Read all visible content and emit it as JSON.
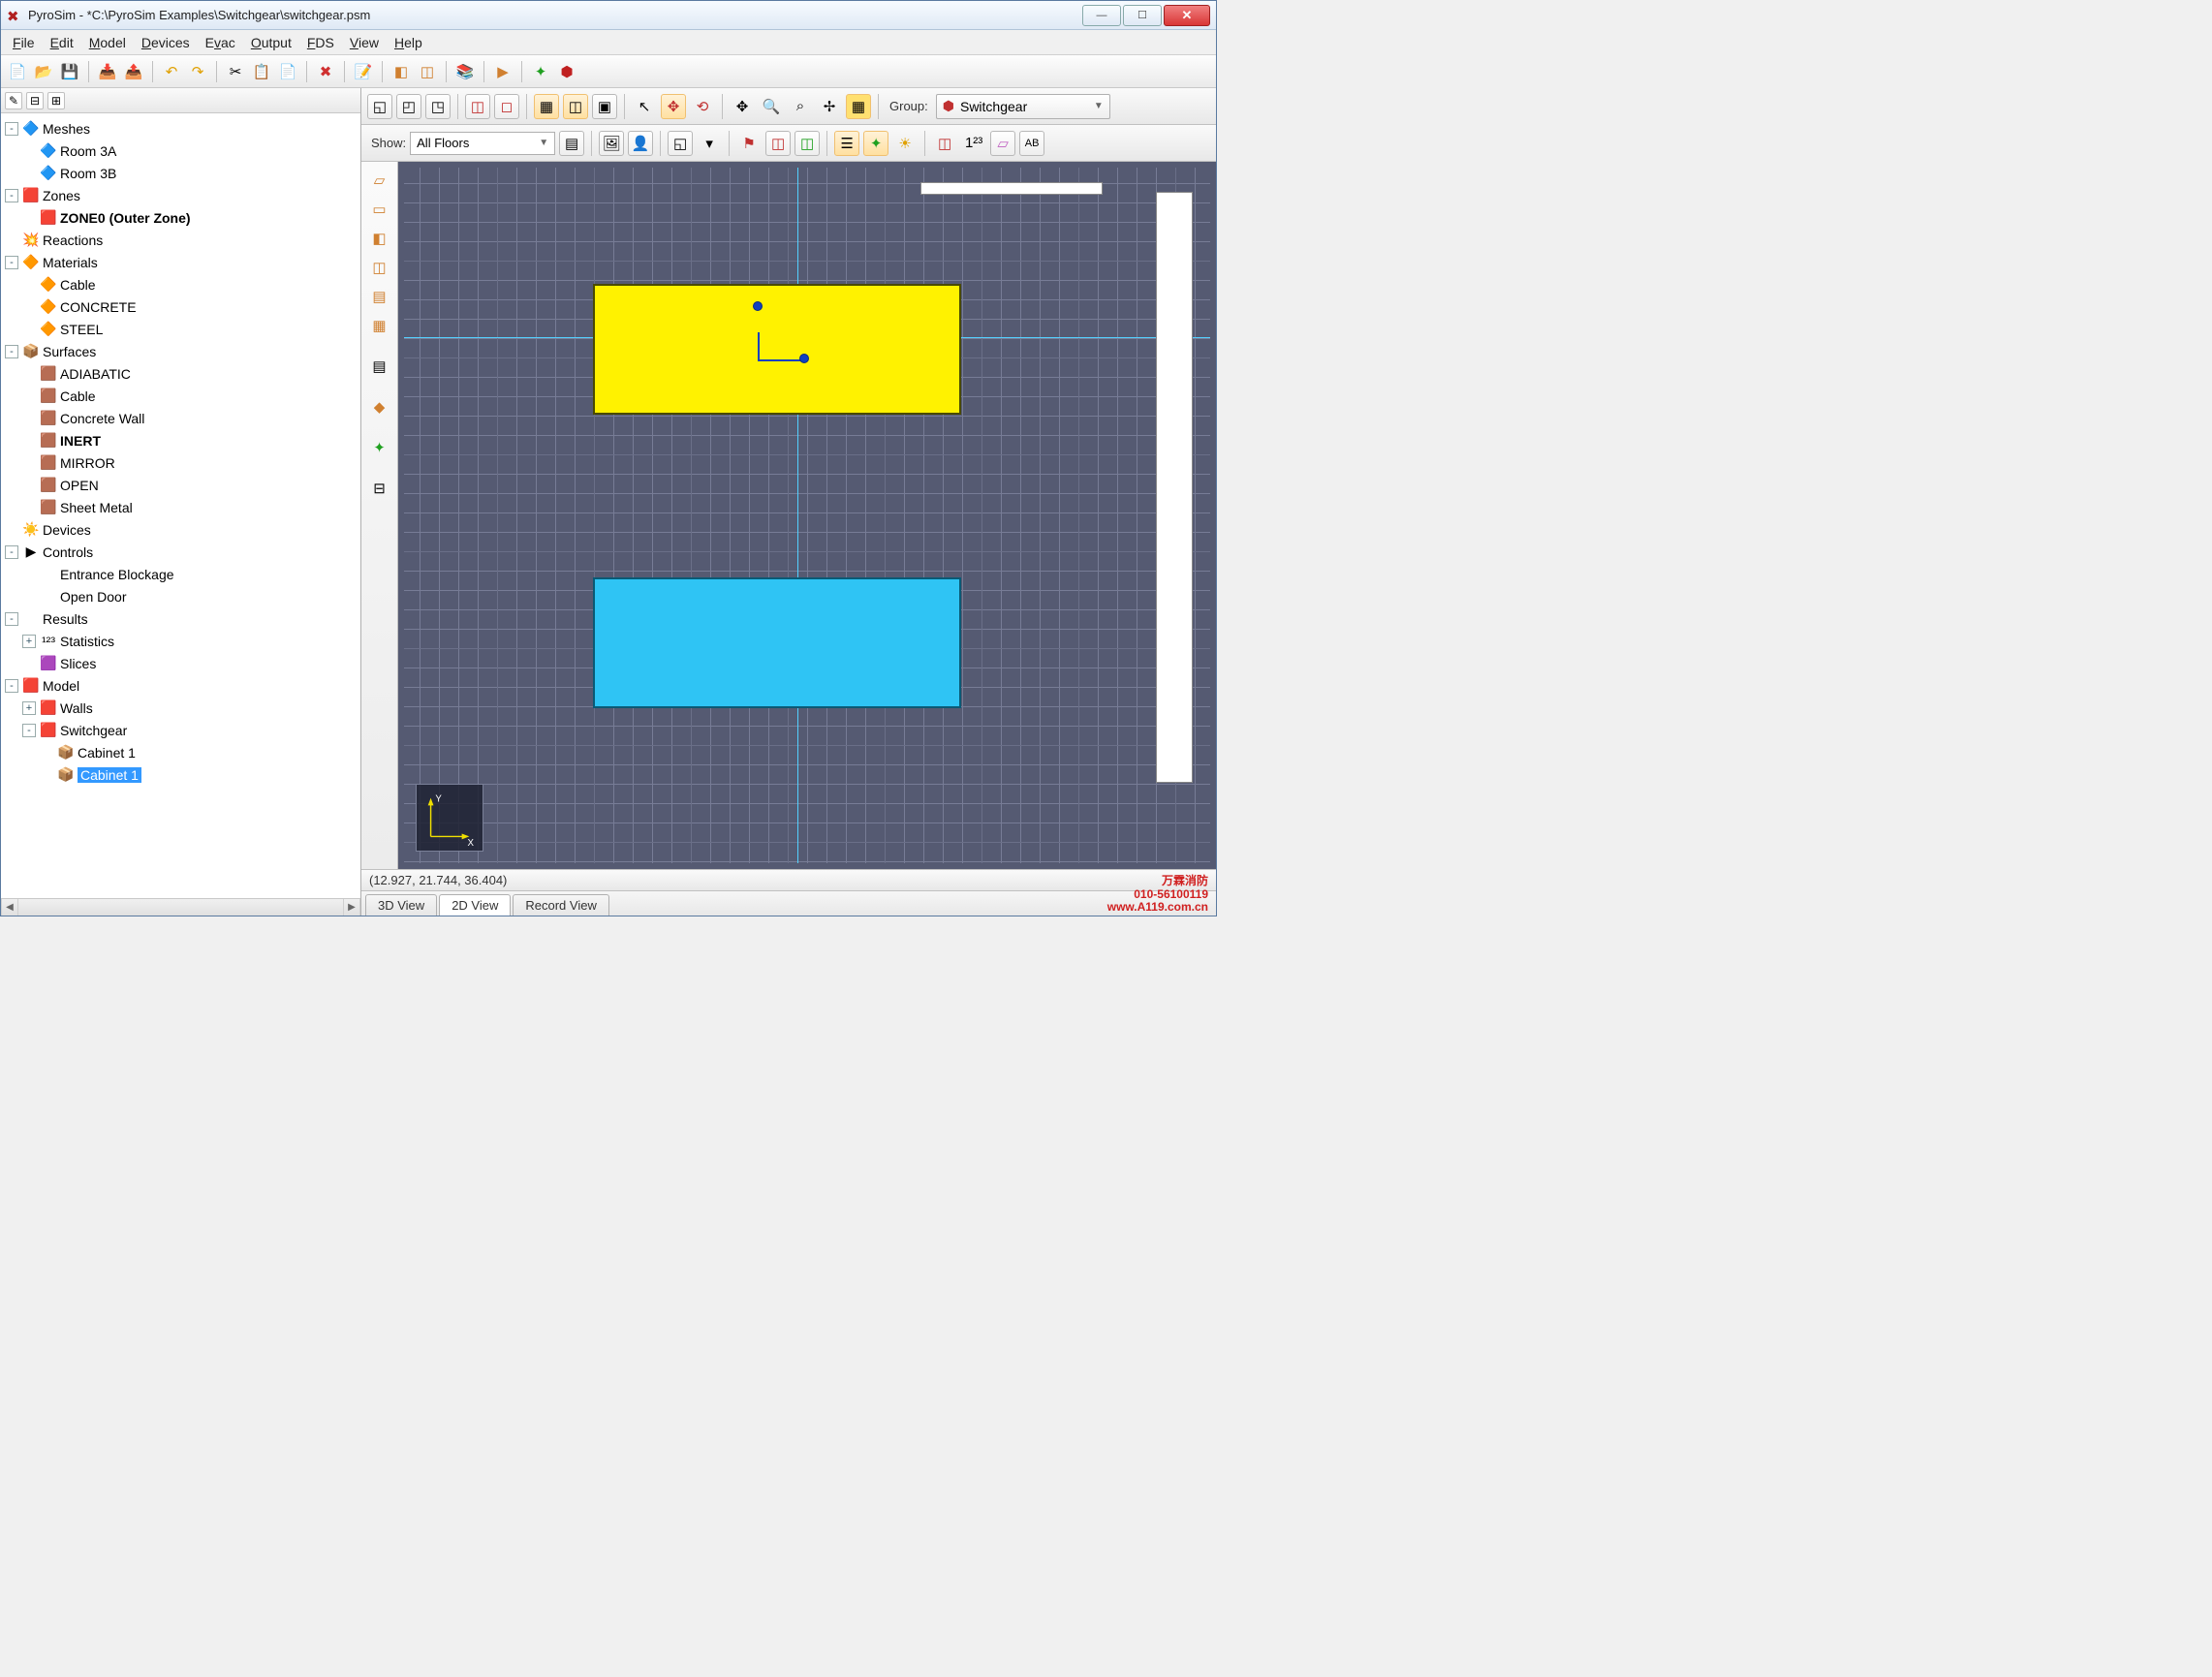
{
  "title": "PyroSim - *C:\\PyroSim Examples\\Switchgear\\switchgear.psm",
  "menus": [
    "File",
    "Edit",
    "Model",
    "Devices",
    "Evac",
    "Output",
    "FDS",
    "View",
    "Help"
  ],
  "menu_accelerators": [
    "F",
    "E",
    "M",
    "D",
    "v",
    "O",
    "F",
    "V",
    "H"
  ],
  "group_label": "Group:",
  "group_value": "Switchgear",
  "show_label": "Show:",
  "floors_value": "All Floors",
  "coords": "(12.927, 21.744, 36.404)",
  "tabs": {
    "t3d": "3D View",
    "t2d": "2D View",
    "trec": "Record View"
  },
  "watermark": {
    "l1": "万霖消防",
    "l2": "010-56100119",
    "l3": "www.A119.com.cn"
  },
  "tree": [
    {
      "d": 0,
      "t": "-",
      "i": "🔷",
      "l": "Meshes"
    },
    {
      "d": 1,
      "t": "",
      "i": "🔷",
      "l": "Room 3A"
    },
    {
      "d": 1,
      "t": "",
      "i": "🔷",
      "l": "Room 3B"
    },
    {
      "d": 0,
      "t": "-",
      "i": "🟥",
      "l": "Zones"
    },
    {
      "d": 1,
      "t": "",
      "i": "🟥",
      "l": "ZONE0 (Outer Zone)",
      "b": true
    },
    {
      "d": 0,
      "t": "",
      "i": "💥",
      "l": "Reactions"
    },
    {
      "d": 0,
      "t": "-",
      "i": "🔶",
      "l": "Materials"
    },
    {
      "d": 1,
      "t": "",
      "i": "🔶",
      "l": "Cable"
    },
    {
      "d": 1,
      "t": "",
      "i": "🔶",
      "l": "CONCRETE"
    },
    {
      "d": 1,
      "t": "",
      "i": "🔶",
      "l": "STEEL"
    },
    {
      "d": 0,
      "t": "-",
      "i": "📦",
      "l": "Surfaces"
    },
    {
      "d": 1,
      "t": "",
      "i": "🟫",
      "l": "ADIABATIC"
    },
    {
      "d": 1,
      "t": "",
      "i": "🟫",
      "l": "Cable"
    },
    {
      "d": 1,
      "t": "",
      "i": "🟫",
      "l": "Concrete Wall"
    },
    {
      "d": 1,
      "t": "",
      "i": "🟫",
      "l": "INERT",
      "b": true
    },
    {
      "d": 1,
      "t": "",
      "i": "🟫",
      "l": "MIRROR"
    },
    {
      "d": 1,
      "t": "",
      "i": "🟫",
      "l": "OPEN"
    },
    {
      "d": 1,
      "t": "",
      "i": "🟫",
      "l": "Sheet Metal"
    },
    {
      "d": 0,
      "t": "",
      "i": "☀️",
      "l": "Devices"
    },
    {
      "d": 0,
      "t": "-",
      "i": "▶",
      "l": "Controls"
    },
    {
      "d": 1,
      "t": "",
      "i": "",
      "l": "Entrance Blockage"
    },
    {
      "d": 1,
      "t": "",
      "i": "",
      "l": "Open Door"
    },
    {
      "d": 0,
      "t": "-",
      "i": "",
      "l": "Results"
    },
    {
      "d": 1,
      "t": "+",
      "i": "¹²³",
      "l": "Statistics"
    },
    {
      "d": 1,
      "t": "",
      "i": "🟪",
      "l": "Slices"
    },
    {
      "d": 0,
      "t": "-",
      "i": "🟥",
      "l": "Model"
    },
    {
      "d": 1,
      "t": "+",
      "i": "🟥",
      "l": "Walls"
    },
    {
      "d": 1,
      "t": "-",
      "i": "🟥",
      "l": "Switchgear"
    },
    {
      "d": 2,
      "t": "",
      "i": "📦",
      "l": "Cabinet 1"
    },
    {
      "d": 2,
      "t": "",
      "i": "📦",
      "l": "Cabinet 1",
      "sel": true
    }
  ]
}
